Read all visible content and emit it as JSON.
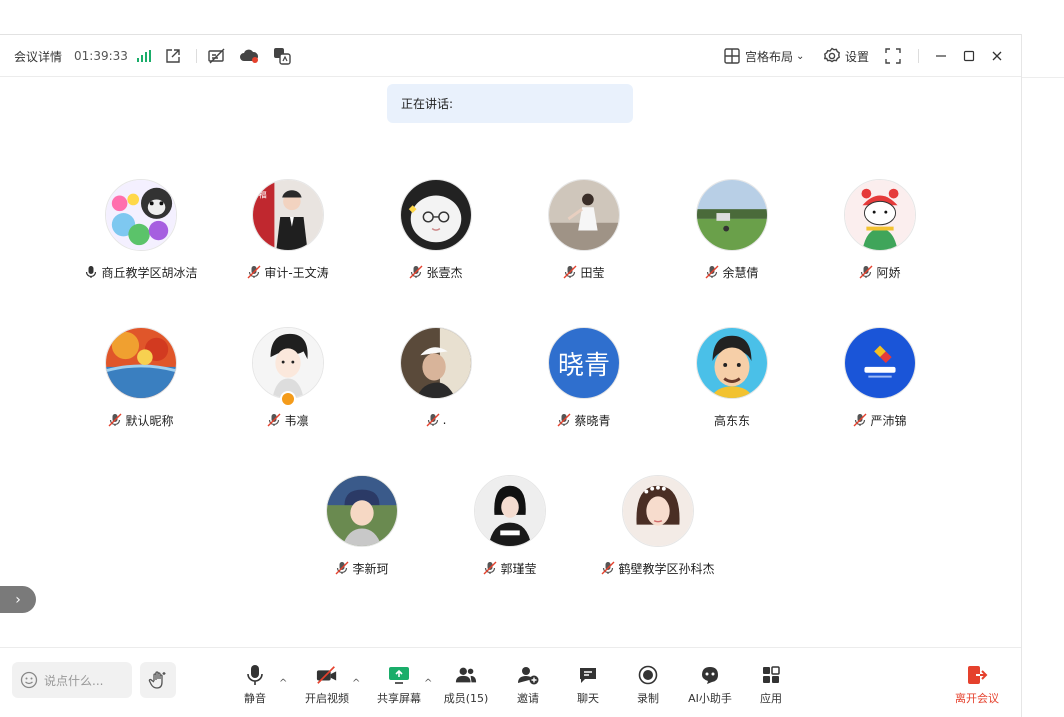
{
  "titlebar": {
    "meeting_details": "会议详情",
    "timer": "01:39:33",
    "layout_label": "宫格布局",
    "settings_label": "设置"
  },
  "speaking": {
    "label": "正在讲话:"
  },
  "participants": [
    {
      "name": "商丘教学区胡冰洁",
      "mic": "on"
    },
    {
      "name": "审计-王文涛",
      "mic": "muted"
    },
    {
      "name": "张壹杰",
      "mic": "muted"
    },
    {
      "name": "田莹",
      "mic": "muted"
    },
    {
      "name": "余慧倩",
      "mic": "muted"
    },
    {
      "name": "阿娇",
      "mic": "muted"
    },
    {
      "name": "默认昵称",
      "mic": "muted"
    },
    {
      "name": "韦凛",
      "mic": "muted"
    },
    {
      "name": ".",
      "mic": "muted"
    },
    {
      "name": "蔡晓青",
      "mic": "muted",
      "avatar_text": "晓青"
    },
    {
      "name": "高东东",
      "mic": "none"
    },
    {
      "name": "严沛锦",
      "mic": "muted"
    },
    {
      "name": "李新珂",
      "mic": "muted"
    },
    {
      "name": "郭瑾莹",
      "mic": "muted"
    },
    {
      "name": "鹤壁教学区孙科杰",
      "mic": "muted"
    }
  ],
  "bottombar": {
    "chat_placeholder": "说点什么...",
    "mute": "静音",
    "video": "开启视频",
    "share": "共享屏幕",
    "members": "成员(15)",
    "invite": "邀请",
    "chat": "聊天",
    "record": "录制",
    "ai": "AI小助手",
    "apps": "应用",
    "leave": "离开会议"
  },
  "colors": {
    "accent": "#1aad6a",
    "leave": "#e5412d",
    "avatar_blue": "#2f6fce",
    "muted_red": "#e5412d"
  }
}
